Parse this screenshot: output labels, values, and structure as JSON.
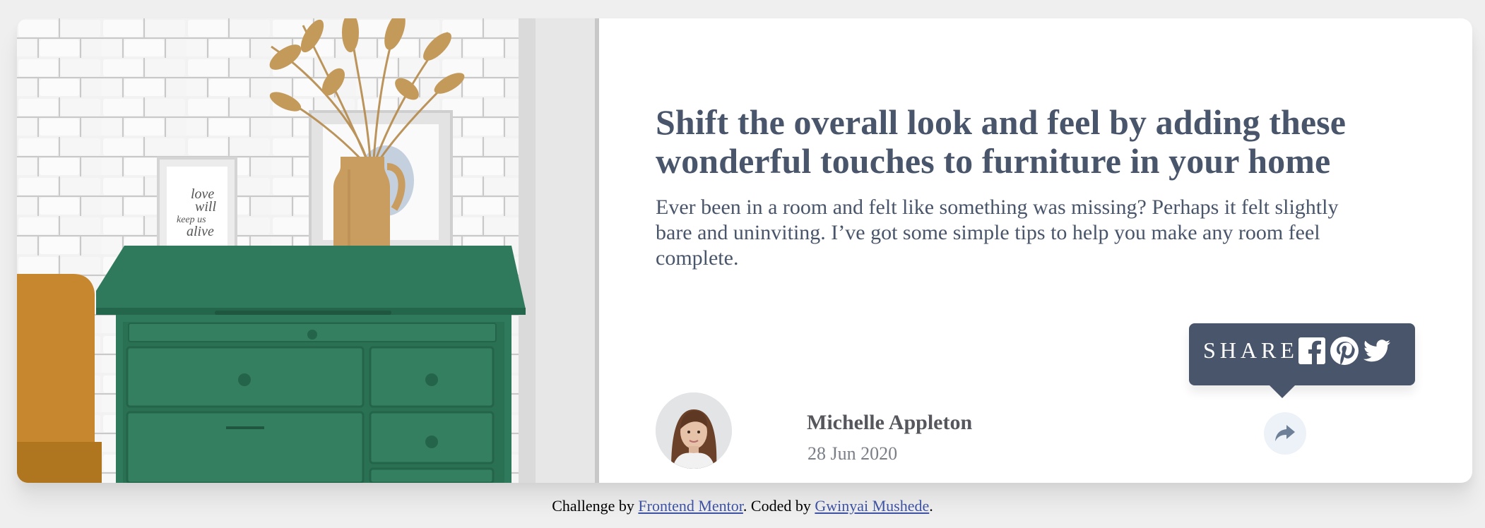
{
  "article": {
    "title": "Shift the overall look and feel by adding these wonderful touches to furniture in your home",
    "description": "Ever been in a room and felt like something was missing? Perhaps it felt slightly bare and uninviting. I’ve got some simple tips to help you make any room feel complete."
  },
  "author": {
    "name": "Michelle Appleton",
    "date": "28 Jun 2020"
  },
  "share": {
    "label": "SHARE",
    "icons": [
      "facebook-icon",
      "pinterest-icon",
      "twitter-icon"
    ],
    "button_icon": "share-arrow-icon"
  },
  "illustration": {
    "frame_text": [
      "love",
      "will",
      "keep us",
      "alive"
    ]
  },
  "colors": {
    "primary_text": "#48556a",
    "tooltip_bg": "#48556a",
    "share_button_bg": "#ecf2f8",
    "footer_link": "#3e52a3"
  },
  "footer": {
    "challenge_prefix": "Challenge by ",
    "challenge_link": "Frontend Mentor",
    "coded_prefix": ". Coded by ",
    "author_link": "Gwinyai Mushede",
    "suffix": "."
  }
}
